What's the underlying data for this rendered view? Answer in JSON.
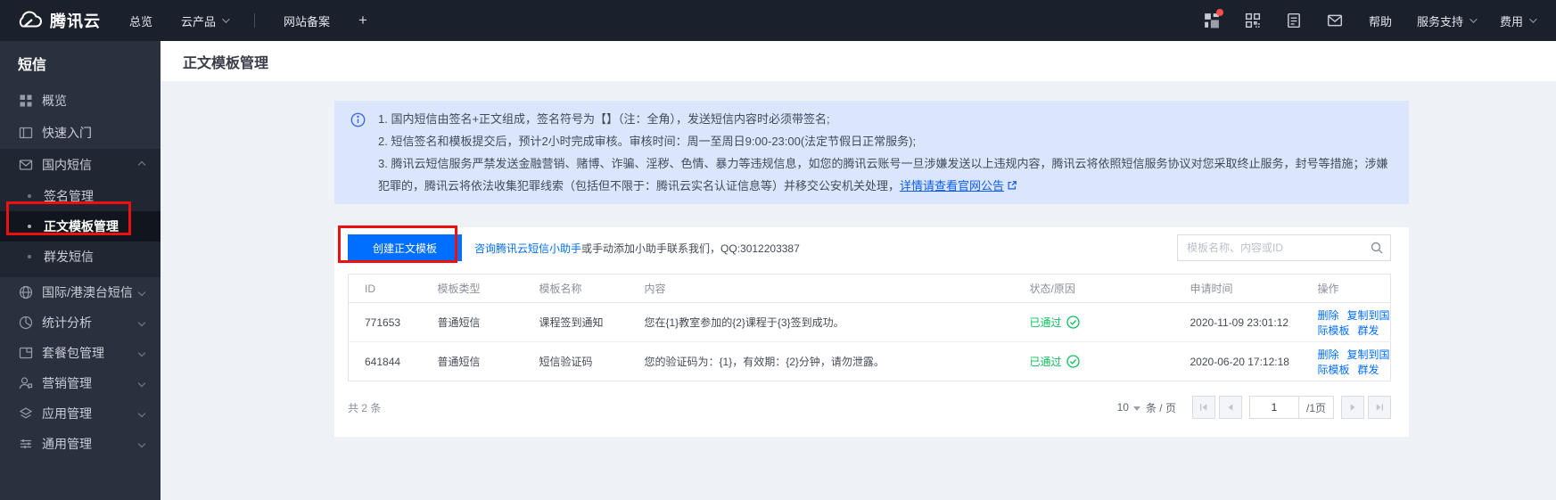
{
  "topnav": {
    "logo": "腾讯云",
    "overview": "总览",
    "products": "云产品",
    "icp": "网站备案",
    "add_tab": "+",
    "help": "帮助",
    "support": "服务支持",
    "billing": "费用"
  },
  "sidebar": {
    "title": "短信",
    "items": [
      {
        "label": "概览"
      },
      {
        "label": "快速入门"
      },
      {
        "label": "国内短信"
      },
      {
        "label": "签名管理"
      },
      {
        "label": "正文模板管理"
      },
      {
        "label": "群发短信"
      },
      {
        "label": "国际/港澳台短信"
      },
      {
        "label": "统计分析"
      },
      {
        "label": "套餐包管理"
      },
      {
        "label": "营销管理"
      },
      {
        "label": "应用管理"
      },
      {
        "label": "通用管理"
      }
    ]
  },
  "page": {
    "title": "正文模板管理",
    "notice": {
      "line1": "1. 国内短信由签名+正文组成，签名符号为【】（注：全角），发送短信内容时必须带签名;",
      "line2": "2. 短信签名和模板提交后，预计2小时完成审核。审核时间：周一至周日9:00-23:00(法定节假日正常服务);",
      "line3": "3. 腾讯云短信服务严禁发送金融营销、赌博、诈骗、淫秽、色情、暴力等违规信息，如您的腾讯云账号一旦涉嫌发送以上违规内容，腾讯云将依照短信服务协议对您采取终止服务，封号等措施；涉嫌犯罪的，腾讯云将依法收集犯罪线索（包括但不限于：腾讯云实名认证信息等）并移交公安机关处理，",
      "link": "详情请查看官网公告"
    },
    "toolbar": {
      "create_button": "创建正文模板",
      "helper_link": "咨询腾讯云短信小助手",
      "helper_text": "或手动添加小助手联系我们，QQ:3012203387",
      "search_placeholder": "模板名称、内容或ID"
    },
    "table": {
      "columns": [
        "ID",
        "模板类型",
        "模板名称",
        "内容",
        "状态/原因",
        "申请时间",
        "操作"
      ],
      "actions": [
        "删除",
        "复制到国际模板",
        "群发"
      ],
      "rows": [
        {
          "id": "771653",
          "type": "普通短信",
          "name": "课程签到通知",
          "content": "您在{1}教室参加的{2}课程于{3}签到成功。",
          "status": "已通过",
          "time": "2020-11-09 23:01:12"
        },
        {
          "id": "641844",
          "type": "普通短信",
          "name": "短信验证码",
          "content": "您的验证码为：{1}，有效期：{2}分钟，请勿泄露。",
          "status": "已通过",
          "time": "2020-06-20 17:12:18"
        }
      ]
    },
    "pagination": {
      "total": "共 2 条",
      "page_size": "10",
      "unit": "条 / 页",
      "page": "1",
      "of": "/1页"
    },
    "colors": {
      "accent_blue": "#006eff",
      "status_green": "#0abf5b",
      "annotation_red": "#ee1010"
    }
  }
}
